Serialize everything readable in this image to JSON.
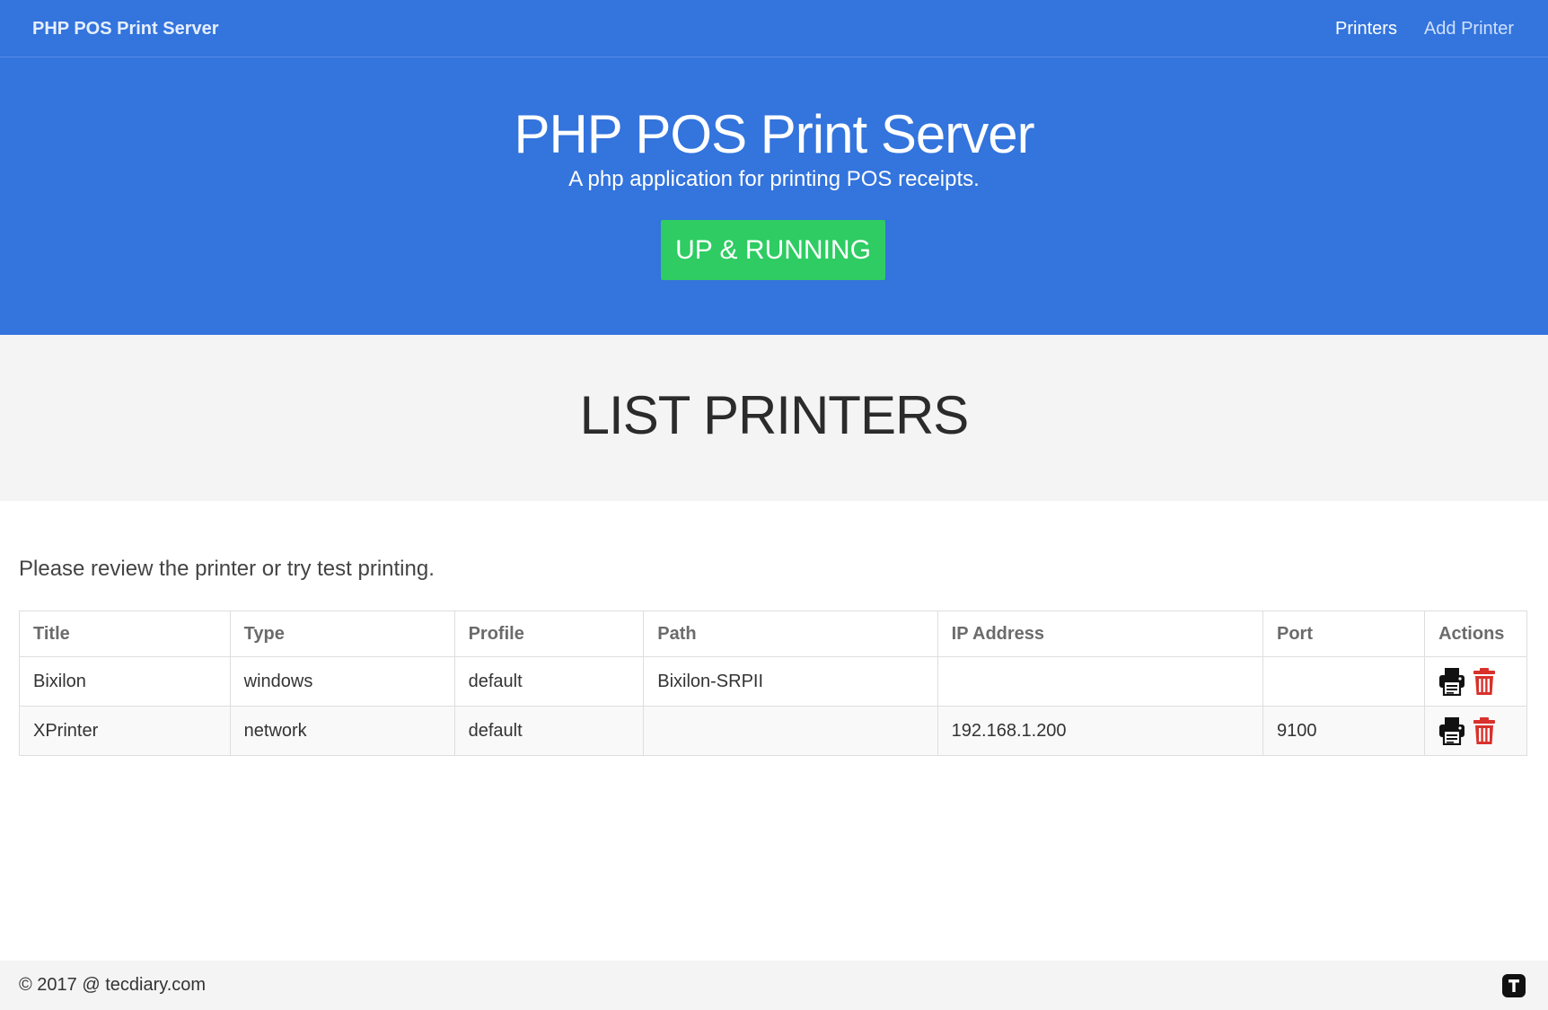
{
  "navbar": {
    "brand": "PHP POS Print Server",
    "links": [
      {
        "label": "Printers",
        "active": true
      },
      {
        "label": "Add Printer",
        "active": false
      }
    ]
  },
  "hero": {
    "title": "PHP POS Print Server",
    "subtitle": "A php application for printing POS receipts.",
    "status_button": "UP & RUNNING"
  },
  "section": {
    "title": "LIST PRINTERS"
  },
  "intro": "Please review the printer or try test printing.",
  "table": {
    "headers": [
      "Title",
      "Type",
      "Profile",
      "Path",
      "IP Address",
      "Port",
      "Actions"
    ],
    "rows": [
      {
        "title": "Bixilon",
        "type": "windows",
        "profile": "default",
        "path": "Bixilon-SRPII",
        "ip": "",
        "port": ""
      },
      {
        "title": "XPrinter",
        "type": "network",
        "profile": "default",
        "path": "",
        "ip": "192.168.1.200",
        "port": "9100"
      }
    ],
    "action_icons": [
      "printer-icon",
      "trash-icon"
    ]
  },
  "footer": {
    "copyright": "© 2017 @ tecdiary.com",
    "logo_icon": "tecdiary-logo-icon"
  },
  "colors": {
    "primary_blue": "#3374dd",
    "status_green": "#2ecc62",
    "delete_red": "#d9312b",
    "section_bg": "#f4f4f4"
  }
}
